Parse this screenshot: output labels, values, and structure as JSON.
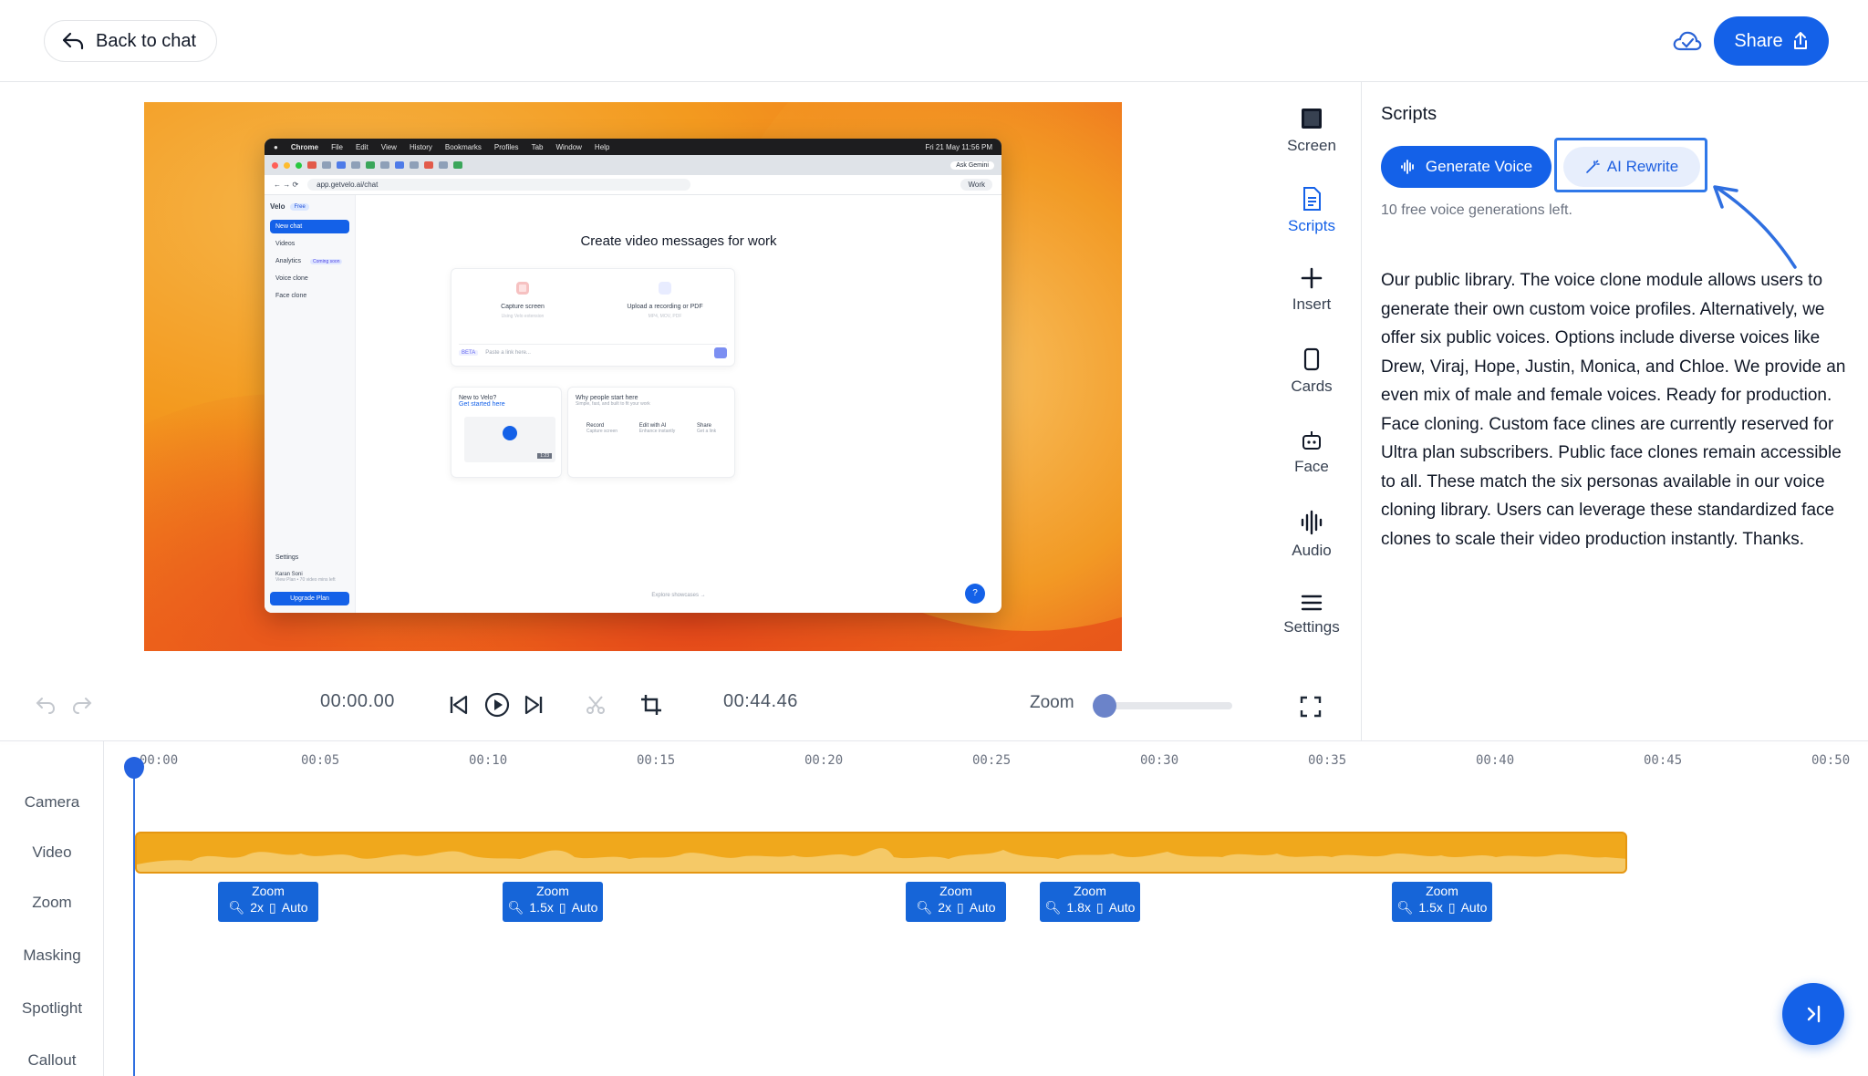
{
  "header": {
    "back_label": "Back to chat",
    "share_label": "Share"
  },
  "preview": {
    "mac_menu": [
      "Chrome",
      "File",
      "Edit",
      "View",
      "History",
      "Bookmarks",
      "Profiles",
      "Tab",
      "Window",
      "Help"
    ],
    "mac_clock": "Fri 21 May 11:56 PM",
    "ask_gemini": "Ask Gemini",
    "url": "app.getvelo.ai/chat",
    "work_pill": "Work",
    "app_logo": "Velo",
    "free_badge": "Free",
    "nav": [
      "New chat",
      "Videos",
      "Analytics",
      "Voice clone",
      "Face clone"
    ],
    "coming_soon": "Coming soon",
    "settings": "Settings",
    "user_name": "Karan Soni",
    "user_plan": "View Plan • 70 video mins left",
    "upgrade": "Upgrade Plan",
    "title": "Create video messages for work",
    "capture_screen": "Capture screen",
    "capture_sub": "Using Velo extension",
    "upload": "Upload a recording or PDF",
    "upload_sub": "MP4, MOV, PDF",
    "or": "OR",
    "beta": "BETA",
    "paste_placeholder": "Paste a link here...",
    "new_to_velo": "New to Velo?",
    "get_started": "Get started here",
    "clip_duration": "1:23",
    "why_start": "Why people start here",
    "why_sub": "Simple, fast, and built to fit your work",
    "actions": [
      {
        "label": "Record",
        "sub": "Capture screen"
      },
      {
        "label": "Edit with AI",
        "sub": "Enhance instantly"
      },
      {
        "label": "Share",
        "sub": "Get a link"
      }
    ],
    "explore": "Explore showcases →",
    "help": "?"
  },
  "tools": [
    {
      "label": "Screen",
      "icon": "screen-icon"
    },
    {
      "label": "Scripts",
      "icon": "scripts-icon"
    },
    {
      "label": "Insert",
      "icon": "plus-icon"
    },
    {
      "label": "Cards",
      "icon": "cards-icon"
    },
    {
      "label": "Face",
      "icon": "face-icon"
    },
    {
      "label": "Audio",
      "icon": "audio-icon"
    },
    {
      "label": "Settings",
      "icon": "menu-icon"
    }
  ],
  "scripts_panel": {
    "title": "Scripts",
    "generate_voice": "Generate Voice",
    "ai_rewrite": "AI Rewrite",
    "free_left": "10 free voice generations left.",
    "text": "Our public library.  The voice clone module allows users to generate their own custom voice profiles.  Alternatively, we offer six public voices.  Options include diverse voices like Drew, Viraj, Hope, Justin, Monica, and Chloe.  We provide an even mix of male and female voices.  Ready for production.  Face cloning.  Custom face clines are currently reserved for  Ultra plan subscribers.  Public face clones remain accessible to all.  These match the six personas available in our voice cloning library.  Users can leverage these standardized face clones to scale their video production instantly.  Thanks."
  },
  "controls": {
    "current_time": "00:00.00",
    "total_time": "00:44.46",
    "zoom_label": "Zoom",
    "zoom_level": 0.0
  },
  "timeline": {
    "ruler": [
      "00:00",
      "00:05",
      "00:10",
      "00:15",
      "00:20",
      "00:25",
      "00:30",
      "00:35",
      "00:40",
      "00:45",
      "00:50"
    ],
    "tracks": [
      "Camera",
      "Video",
      "Zoom",
      "Masking",
      "Spotlight",
      "Callout"
    ],
    "zoom_clips": [
      {
        "title": "Zoom",
        "factor": "2x",
        "mode": "Auto"
      },
      {
        "title": "Zoom",
        "factor": "1.5x",
        "mode": "Auto"
      },
      {
        "title": "Zoom",
        "factor": "2x",
        "mode": "Auto"
      },
      {
        "title": "Zoom",
        "factor": "1.8x",
        "mode": "Auto"
      },
      {
        "title": "Zoom",
        "factor": "1.5x",
        "mode": "Auto"
      }
    ]
  },
  "colors": {
    "accent": "#1461e8",
    "video_track": "#f0a81c",
    "zoom_clip": "#1665d8"
  }
}
